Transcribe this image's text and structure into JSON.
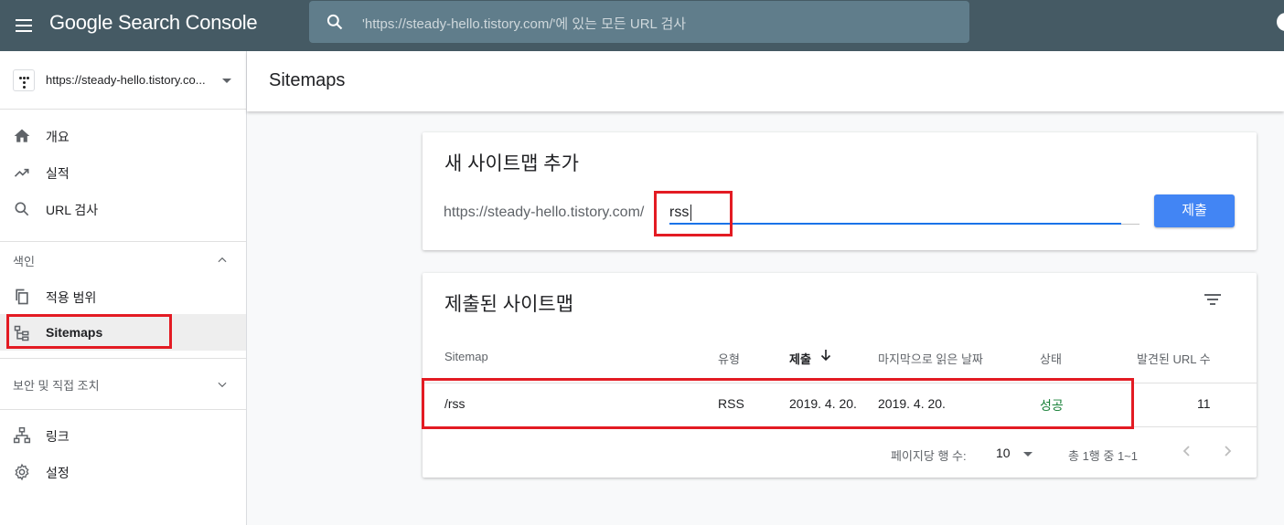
{
  "app": {
    "title": "Google Search Console"
  },
  "search": {
    "placeholder": "'https://steady-hello.tistory.com/'에 있는 모든 URL 검사"
  },
  "sidebar": {
    "property": "https://steady-hello.tistory.co...",
    "items": [
      {
        "label": "개요",
        "icon": "home-icon"
      },
      {
        "label": "실적",
        "icon": "trending-up-icon"
      },
      {
        "label": "URL 검사",
        "icon": "search-icon"
      }
    ],
    "index_section": {
      "title": "색인",
      "items": [
        {
          "label": "적용 범위",
          "icon": "copy-icon"
        },
        {
          "label": "Sitemaps",
          "icon": "sitemap-icon"
        }
      ]
    },
    "security_section": {
      "title": "보안 및 직접 조치"
    },
    "bottom_items": [
      {
        "label": "링크",
        "icon": "links-icon"
      },
      {
        "label": "설정",
        "icon": "settings-icon"
      }
    ]
  },
  "page": {
    "title": "Sitemaps"
  },
  "add_sitemap": {
    "title": "새 사이트맵 추가",
    "prefix": "https://steady-hello.tistory.com/",
    "input_value": "rss",
    "submit_label": "제출"
  },
  "submitted": {
    "title": "제출된 사이트맵",
    "columns": {
      "sitemap": "Sitemap",
      "type": "유형",
      "submitted": "제출",
      "last_read": "마지막으로 읽은 날짜",
      "status": "상태",
      "urls": "발견된 URL 수"
    },
    "rows": [
      {
        "sitemap": "/rss",
        "type": "RSS",
        "submitted": "2019. 4. 20.",
        "last_read": "2019. 4. 20.",
        "status": "성공",
        "urls": "11"
      }
    ],
    "pagination": {
      "rows_per_page_label": "페이지당 행 수:",
      "rows_per_page": "10",
      "range": "총 1행 중 1~1"
    }
  },
  "colors": {
    "topbar": "#455a64",
    "accent": "#4285f4",
    "success": "#188038",
    "highlight": "#e31b23"
  }
}
